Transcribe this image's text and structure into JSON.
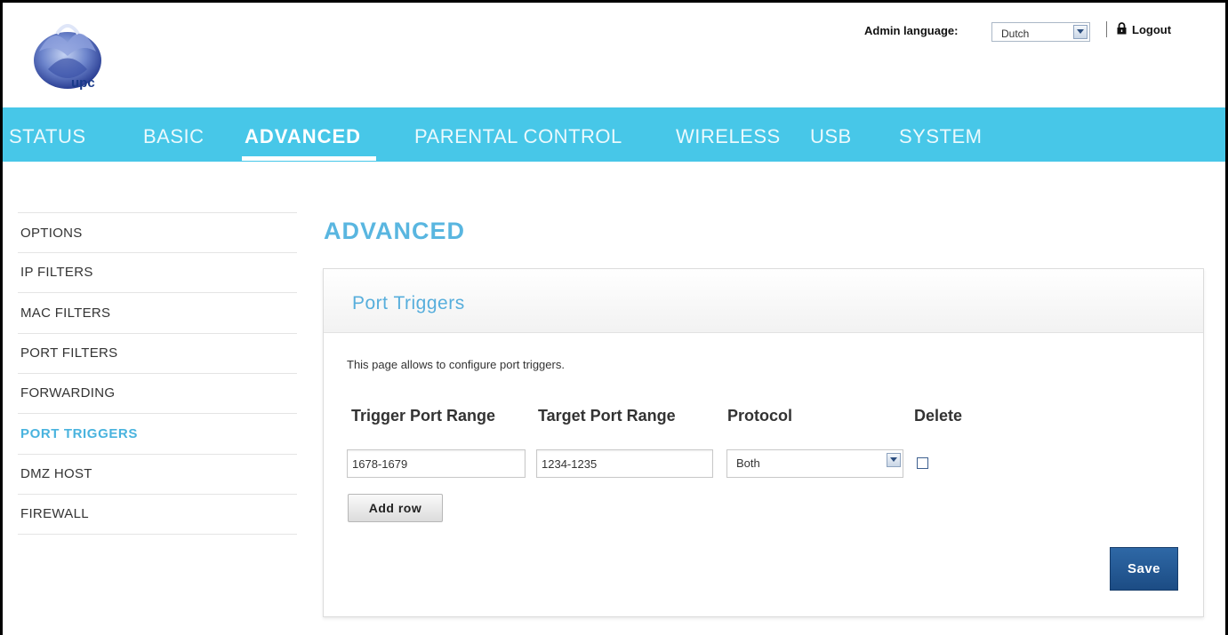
{
  "header": {
    "logo_text": "upc",
    "admin_language_label": "Admin language:",
    "language_value": "Dutch",
    "logout_label": "Logout"
  },
  "nav": {
    "items": [
      "STATUS",
      "BASIC",
      "ADVANCED",
      "PARENTAL CONTROL",
      "WIRELESS",
      "USB",
      "SYSTEM"
    ],
    "active": "ADVANCED"
  },
  "sidebar": {
    "items": [
      "OPTIONS",
      "IP FILTERS",
      "MAC FILTERS",
      "PORT FILTERS",
      "FORWARDING",
      "PORT TRIGGERS",
      "DMZ HOST",
      "FIREWALL"
    ],
    "active": "PORT TRIGGERS"
  },
  "main": {
    "page_title": "ADVANCED",
    "panel_title": "Port Triggers",
    "description": "This page allows to configure port triggers.",
    "columns": [
      "Trigger Port Range",
      "Target Port Range",
      "Protocol",
      "Delete"
    ],
    "row": {
      "trigger_port_range": "1678-1679",
      "target_port_range": "1234-1235",
      "protocol": "Both",
      "delete_checked": false
    },
    "add_row_label": "Add row",
    "save_label": "Save"
  },
  "colors": {
    "nav_bg": "#47c7e8",
    "accent_blue": "#59b6e0",
    "save_button": "#1f5290"
  },
  "icons": [
    "upc-logo",
    "chevron-down-icon",
    "lock-icon"
  ]
}
